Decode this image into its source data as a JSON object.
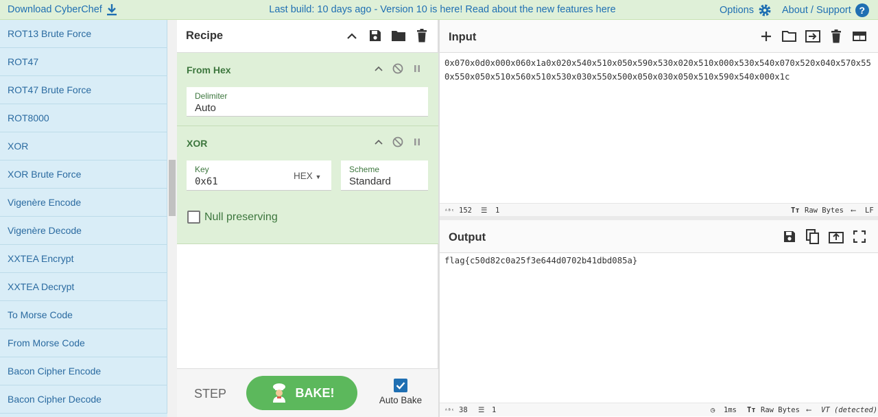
{
  "banner": {
    "download": "Download CyberChef",
    "news": "Last build: 10 days ago - Version 10 is here! Read about the new features here",
    "options": "Options",
    "about": "About / Support"
  },
  "operations": [
    "ROT13 Brute Force",
    "ROT47",
    "ROT47 Brute Force",
    "ROT8000",
    "XOR",
    "XOR Brute Force",
    "Vigenère Encode",
    "Vigenère Decode",
    "XXTEA Encrypt",
    "XXTEA Decrypt",
    "To Morse Code",
    "From Morse Code",
    "Bacon Cipher Encode",
    "Bacon Cipher Decode"
  ],
  "recipe": {
    "title": "Recipe",
    "from_hex": {
      "title": "From Hex",
      "delimiter_label": "Delimiter",
      "delimiter_value": "Auto"
    },
    "xor": {
      "title": "XOR",
      "key_label": "Key",
      "key_value": "0x61",
      "key_format": "HEX",
      "scheme_label": "Scheme",
      "scheme_value": "Standard",
      "null_preserving": "Null preserving"
    },
    "step": "STEP",
    "bake": "BAKE!",
    "autobake": "Auto Bake"
  },
  "input": {
    "title": "Input",
    "text": "0x070x0d0x000x060x1a0x020x540x510x050x590x530x020x510x000x530x540x070x520x040x570x550x550x050x510x560x510x530x030x550x500x050x030x050x510x590x540x000x1c",
    "chars": "152",
    "lines": "1",
    "encoding": "Raw Bytes",
    "eol": "LF"
  },
  "output": {
    "title": "Output",
    "text": "flag{c50d82c0a25f3e644d0702b41dbd085a}",
    "chars": "38",
    "lines": "1",
    "time": "1ms",
    "encoding": "Raw Bytes",
    "eol": "VT (detected)"
  }
}
